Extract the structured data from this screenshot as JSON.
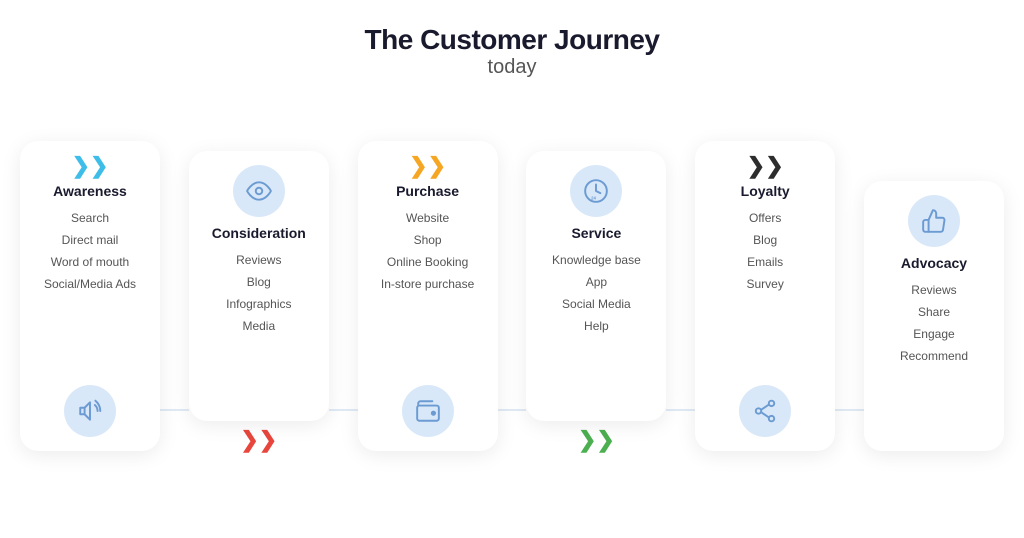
{
  "header": {
    "title": "The Customer Journey",
    "subtitle": "today"
  },
  "stages": [
    {
      "id": "awareness",
      "title": "Awareness",
      "arrow_top_color": "blue",
      "arrow_bottom": false,
      "items": [
        "Search",
        "Direct mail",
        "Word of mouth",
        "Social/Media Ads"
      ],
      "icon_bottom": "megaphone",
      "tall": true
    },
    {
      "id": "consideration",
      "title": "Consideration",
      "arrow_top": false,
      "arrow_bottom_color": "red",
      "items": [
        "Reviews",
        "Blog",
        "Infographics",
        "Media"
      ],
      "icon_top": "eye",
      "tall": false
    },
    {
      "id": "purchase",
      "title": "Purchase",
      "arrow_top_color": "orange",
      "arrow_bottom": false,
      "items": [
        "Website",
        "Shop",
        "Online Booking",
        "In-store purchase"
      ],
      "icon_bottom": "wallet",
      "tall": true
    },
    {
      "id": "service",
      "title": "Service",
      "arrow_top": false,
      "arrow_bottom_color": "green",
      "items": [
        "Knowledge base",
        "App",
        "Social Media",
        "Help"
      ],
      "icon_top": "clock24",
      "tall": false
    },
    {
      "id": "loyalty",
      "title": "Loyalty",
      "arrow_top_color": "dark",
      "arrow_bottom": false,
      "items": [
        "Offers",
        "Blog",
        "Emails",
        "Survey"
      ],
      "icon_bottom": "share",
      "tall": true
    },
    {
      "id": "advocacy",
      "title": "Advocacy",
      "arrow_top": false,
      "arrow_bottom": false,
      "items": [
        "Reviews",
        "Share",
        "Engage",
        "Recommend"
      ],
      "icon_top": "thumbsup",
      "tall": false
    }
  ]
}
